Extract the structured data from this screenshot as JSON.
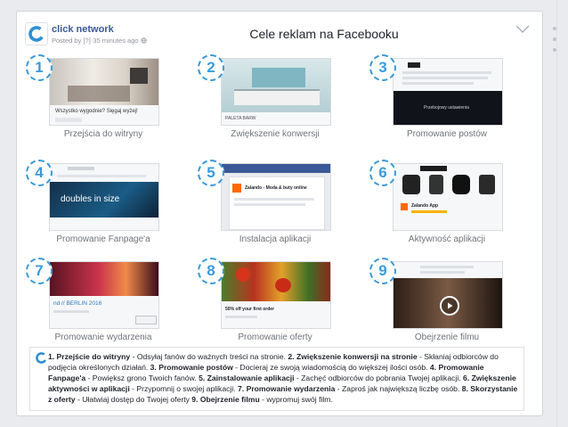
{
  "header": {
    "brand": "click network",
    "posted": "Posted by [?]·35 minutes ago",
    "title": "Cele reklam na Facebooku"
  },
  "tiles": [
    {
      "num": "1",
      "label": "Przejścia do witryny",
      "caption": "Wszystko wygodnie? Sięgaj wyżej!"
    },
    {
      "num": "2",
      "label": "Zwiększenie konwersji",
      "caption": "PALETA BARW"
    },
    {
      "num": "3",
      "label": "Promowanie postów",
      "caption": "Przebojowy ustawienia"
    },
    {
      "num": "4",
      "label": "Promowanie Fanpage'a",
      "caption": "doubles in size"
    },
    {
      "num": "5",
      "label": "Instalacja aplikacji",
      "caption": "Zalando - Moda & buty online"
    },
    {
      "num": "6",
      "label": "Aktywność aplikacji",
      "caption": "Zalando App"
    },
    {
      "num": "7",
      "label": "Promowanie wydarzenia",
      "caption": "nd // BERLIN 2016"
    },
    {
      "num": "8",
      "label": "Promowanie oferty",
      "caption": "50% off your first order"
    },
    {
      "num": "9",
      "label": "Obejrzenie filmu",
      "caption": ""
    }
  ],
  "footer": {
    "parts": [
      {
        "b": "1. Przejście do witryny",
        "t": " - Odsyłaj fanów do ważnych treści na stronie. "
      },
      {
        "b": "2. Zwiększenie konwersji na stronie",
        "t": " - Skłaniaj odbiorców do podjęcia określonych działań. "
      },
      {
        "b": "3. Promowanie postów",
        "t": " - Docieraj ze swoją wiadomością do większej ilości osób. "
      },
      {
        "b": "4. Promowanie Fanpage'a",
        "t": " - Powiększ grono Twoich fanów. "
      },
      {
        "b": "5. Zainstalowanie aplikacji",
        "t": " - Zachęć odbiorców do pobrania Twojej aplikacji. "
      },
      {
        "b": "6. Zwiększenie aktywności w aplikacji",
        "t": " - Przypomnij o swojej aplikacji. "
      },
      {
        "b": "7. Promowanie wydarzenia",
        "t": " - Zaproś jak największą liczbę osób. "
      },
      {
        "b": "8. Skorzystanie z oferty",
        "t": " - Ułatwiaj dostęp do Twojej oferty "
      },
      {
        "b": "9. Obejrzenie filmu",
        "t": " - wypromuj swój film."
      }
    ]
  },
  "colors": {
    "accent": "#3a9ad9",
    "brand": "#3b5998"
  },
  "icons": [
    "click-network-logo-icon",
    "globe-icon",
    "chevron-down-icon",
    "play-icon"
  ]
}
